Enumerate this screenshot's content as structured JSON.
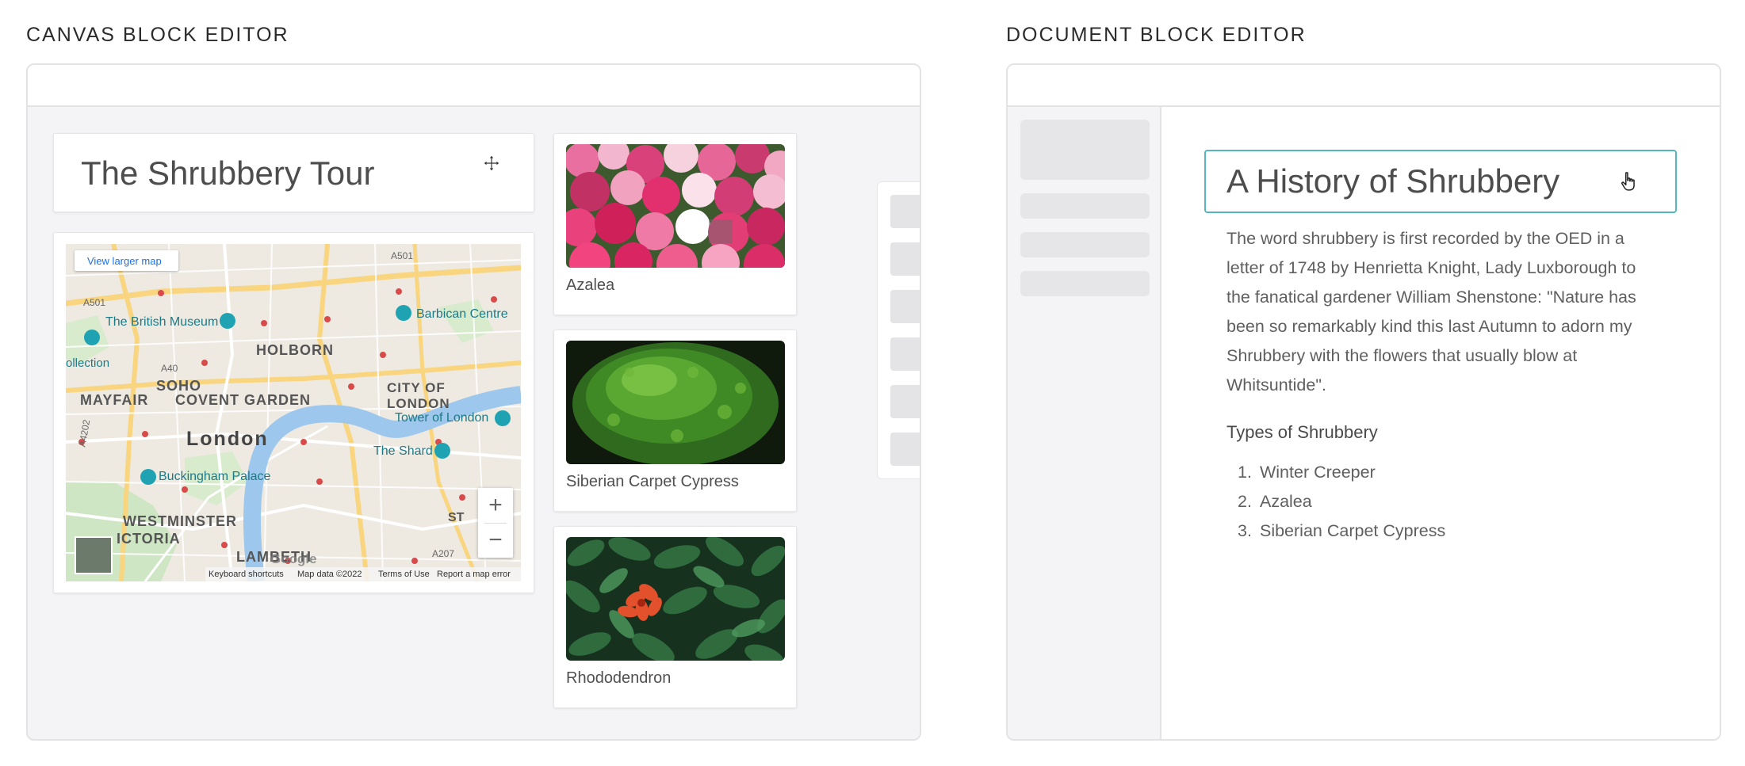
{
  "canvas_editor": {
    "heading": "CANVAS BLOCK EDITOR",
    "title_block": {
      "text": "The Shrubbery Tour",
      "icon": "move-icon"
    },
    "map_block": {
      "view_larger": "View larger map",
      "labels": {
        "british_museum": "The British Museum",
        "barbican": "Barbican Centre",
        "holborn": "HOLBORN",
        "collection": "ollection",
        "soho": "SOHO",
        "city_of": "CITY OF",
        "london_city": "LONDON",
        "mayfair": "MAYFAIR",
        "covent_garden": "COVENT GARDEN",
        "tower": "Tower of London",
        "london": "London",
        "shard": "The Shard",
        "buckingham": "Buckingham Palace",
        "westminster": "WESTMINSTER",
        "victoria": "ICTORIA",
        "lambeth": "LAMBETH",
        "st": "ST",
        "a501": "A501",
        "a501b": "A501",
        "a40": "A40",
        "a4202": "A4202",
        "a207": "A207"
      },
      "zoom_in": "+",
      "zoom_out": "−",
      "google": "Google",
      "footer": {
        "shortcuts": "Keyboard shortcuts",
        "data": "Map data ©2022",
        "terms": "Terms of Use",
        "report": "Report a map error"
      }
    },
    "images": [
      {
        "caption": "Azalea"
      },
      {
        "caption": "Siberian Carpet Cypress"
      },
      {
        "caption": "Rhododendron"
      }
    ]
  },
  "document_editor": {
    "heading": "DOCUMENT BLOCK EDITOR",
    "title": "A History of Shrubbery",
    "title_icon": "pointer-hand-icon",
    "paragraph": "The word shrubbery is first recorded by the OED in a letter of 1748 by Henrietta Knight, Lady Luxborough to the fanatical gardener William Shenstone: \"Nature has been so remarkably kind this last Autumn to adorn my Shrubbery with the flowers that usually blow at Whitsuntide\".",
    "subheading": "Types of Shrubbery",
    "list": [
      "Winter Creeper",
      "Azalea",
      "Siberian Carpet Cypress"
    ],
    "list_numbers": [
      "1.",
      "2.",
      "3."
    ]
  },
  "colors": {
    "accent": "#55b6c2",
    "frame_bg": "#f4f4f6",
    "border": "#e3e3e6"
  }
}
